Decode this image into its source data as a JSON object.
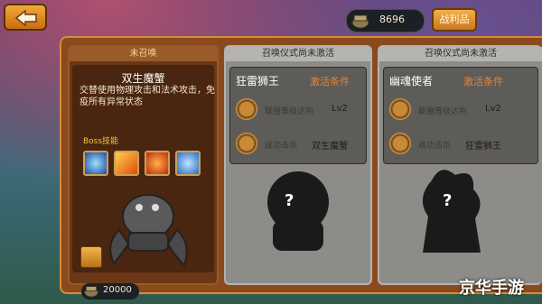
{
  "currency": {
    "icon": "coin-pouch-icon",
    "value": "8696"
  },
  "header": {
    "loot_label": "战利品"
  },
  "cards": [
    {
      "status": "未召唤",
      "hero_name": "双生魔蟹",
      "description": "交替使用物理攻击和法术攻击，免疫所有异常状态",
      "skills_label": "Boss技能",
      "skills": [
        "ice-claw-icon",
        "fire-claw-icon",
        "flame-slash-icon",
        "bubble-icon"
      ],
      "cost": "20000"
    },
    {
      "status": "召唤仪式尚未激活",
      "hero_name": "狂雷狮王",
      "condition_title": "激活条件",
      "conditions": [
        {
          "text": "联盟等级达到",
          "value": "Lv2"
        },
        {
          "text": "成功击杀",
          "value": "双生魔蟹"
        }
      ],
      "hidden_mark": "?"
    },
    {
      "status": "召唤仪式尚未激活",
      "hero_name": "幽魂使者",
      "condition_title": "激活条件",
      "conditions": [
        {
          "text": "联盟等级达到",
          "value": "Lv2"
        },
        {
          "text": "成功击杀",
          "value": "狂雷狮王"
        }
      ],
      "hidden_mark": "?"
    }
  ],
  "watermark": "京华手游"
}
